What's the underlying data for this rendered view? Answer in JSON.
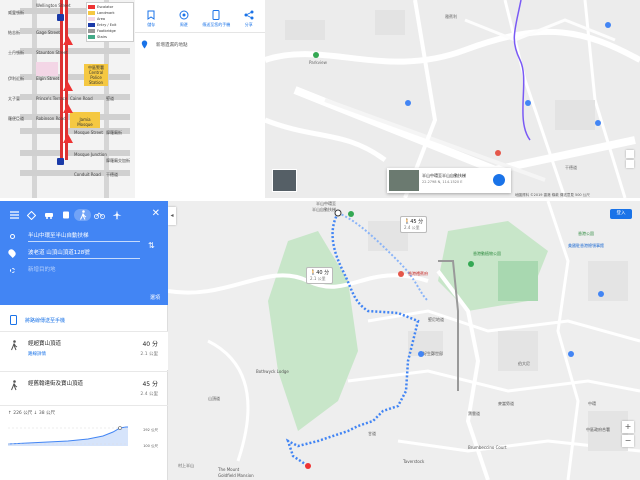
{
  "diagram": {
    "streets": [
      "Wellington Street",
      "Stanley Street",
      "Lyndhurst Terrace",
      "Gage Street",
      "Peel Street",
      "Staunton Street",
      "Elgin Street",
      "Shelley Street",
      "Caine Road",
      "Prince's Terrace",
      "Robinson Road",
      "Mosque Street",
      "Mosque Junction",
      "Conduit Road"
    ],
    "streets_zh": [
      "威靈頓街",
      "士丹利街",
      "擺花街",
      "結志街",
      "卑利街",
      "士丹頓街",
      "伊利近街",
      "些利街",
      "堅道",
      "太子臺",
      "羅便臣道",
      "摩羅廟街",
      "摩羅廟交加街",
      "干德道"
    ],
    "legend": [
      {
        "color": "#e33",
        "label": "Escalator"
      },
      {
        "color": "#f5c842",
        "label": "Landmark"
      },
      {
        "color": "#f3d6e6",
        "label": "Area"
      },
      {
        "color": "#1a3aa8",
        "label": "Entry / Exit"
      },
      {
        "color": "#999",
        "label": "Footbridge"
      },
      {
        "color": "#4a8",
        "label": "Stairs"
      }
    ],
    "landmarks": [
      "中區警署 Central Police Station",
      "Jamia Mosque",
      "回教清真禮拜總堂"
    ]
  },
  "infopanel": {
    "actions": [
      {
        "icon": "bookmark-icon",
        "label": "儲存"
      },
      {
        "icon": "nearby-icon",
        "label": "周邊"
      },
      {
        "icon": "phone-icon",
        "label": "傳送至您的手機"
      },
      {
        "icon": "share-icon",
        "label": "分享"
      }
    ],
    "add_missing": "新增遺漏的地點"
  },
  "topmap": {
    "labels": [
      "雅賓利",
      "Parkview",
      "半山自動扶梯",
      "中環",
      "干德道"
    ],
    "streetcard_title": "半山中環至半山自動扶梯",
    "streetcard_sub": "22.2798 N, 114.1520 E",
    "footer": "地圖資料 ©2019   香港   條款   傳送意見   500 公尺"
  },
  "directions": {
    "modes": [
      "driving-icon",
      "transit-icon",
      "walking-icon",
      "cycling-icon",
      "flight-icon"
    ],
    "origin": "半山中環至半山自動扶梯",
    "destination": "波老道 山頂山頂道128號",
    "add_destination": "新增目的地",
    "options": "選項",
    "send_phone": "將路線傳送至手機",
    "routes": [
      {
        "name": "經超寶山頂道",
        "sub": "路線詳情",
        "time": "40 分",
        "dist": "2.1 公里"
      },
      {
        "name": "經舊翰達街及寶山頂道",
        "sub": "",
        "time": "45 分",
        "dist": "2.4 公里"
      }
    ],
    "elevation": {
      "summary": "↑ 226 公尺  ↓ 38 公尺",
      "high": "292 公尺",
      "low": "100 公尺"
    }
  },
  "mainmap": {
    "bubbles": [
      {
        "time": "45 分",
        "dist": "2.4 公里"
      },
      {
        "time": "40 分",
        "dist": "2.1 公里"
      }
    ],
    "labels": [
      "半山中環至",
      "半山自動扶梯",
      "香港動植物公園",
      "香港禮賓府",
      "香港公園",
      "好生鄭世邸",
      "Bothwyck Lodge",
      "山頂道",
      "甘道",
      "Taverstock",
      "Brumbeccino Court",
      "中環",
      "美國駐香港總領事館",
      "村上半山",
      "The Mount",
      "Goldfield Mansion",
      "伯大尼",
      "麥當勞道",
      "堅尼地道",
      "寶雲道",
      "中區政府合署"
    ],
    "login": "登入"
  }
}
